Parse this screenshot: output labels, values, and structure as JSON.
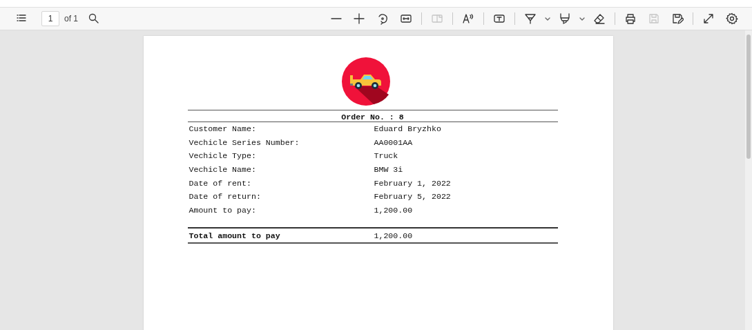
{
  "toolbar": {
    "left": [
      {
        "kind": "contents",
        "disabled": false
      }
    ],
    "page_field": {
      "value": "1"
    },
    "page_count": "of 1",
    "search": {
      "kind": "search",
      "disabled": false
    },
    "right": [
      {
        "kind": "zoomout",
        "disabled": false
      },
      {
        "kind": "zoomin",
        "disabled": false
      },
      {
        "kind": "rotate",
        "disabled": false
      },
      {
        "kind": "fitwidth",
        "disabled": false
      },
      {
        "kind": "separator"
      },
      {
        "kind": "twopage",
        "disabled": true
      },
      {
        "kind": "separator"
      },
      {
        "kind": "readaloud",
        "disabled": false
      },
      {
        "kind": "separator"
      },
      {
        "kind": "textbox",
        "disabled": false
      },
      {
        "kind": "separator"
      },
      {
        "kind": "draw",
        "disabled": false
      },
      {
        "kind": "chevron",
        "disabled": false
      },
      {
        "kind": "highlight",
        "disabled": false
      },
      {
        "kind": "chevron",
        "disabled": false
      },
      {
        "kind": "eraser",
        "disabled": false
      },
      {
        "kind": "separator"
      },
      {
        "kind": "print",
        "disabled": false
      },
      {
        "kind": "save",
        "disabled": true
      },
      {
        "kind": "saveas",
        "disabled": false
      },
      {
        "kind": "separator"
      },
      {
        "kind": "fullscreen",
        "disabled": false
      },
      {
        "kind": "settings",
        "disabled": false
      }
    ]
  },
  "document": {
    "order_title": "Order No. : 8",
    "rows": [
      {
        "label": "Customer Name:",
        "value": "Eduard Bryzhko"
      },
      {
        "label": "Vechicle Series Number:",
        "value": "AA0001AA"
      },
      {
        "label": "Vechicle Type:",
        "value": "Truck"
      },
      {
        "label": "Vechicle Name:",
        "value": "BMW 3i"
      },
      {
        "label": "Date of rent:",
        "value": "February 1, 2022"
      },
      {
        "label": "Date of return:",
        "value": "February 5, 2022"
      },
      {
        "label": "Amount to pay:",
        "value": "1,200.00"
      }
    ],
    "total": {
      "label": "Total amount to pay",
      "value": "1,200.00"
    }
  }
}
